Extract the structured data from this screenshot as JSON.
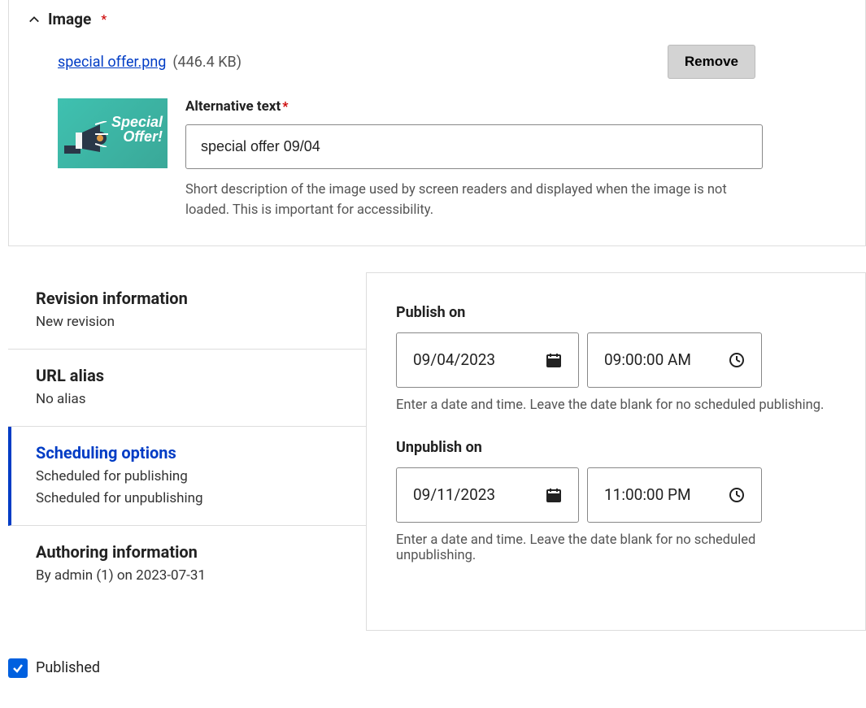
{
  "image_section": {
    "title": "Image",
    "file_name": "special offer.png",
    "file_size": "(446.4 KB)",
    "remove_label": "Remove",
    "thumb_line1": "Special",
    "thumb_line2": "Offer!",
    "alt_label": "Alternative text",
    "alt_value": "special offer 09/04",
    "alt_help": "Short description of the image used by screen readers and displayed when the image is not loaded. This is important for accessibility."
  },
  "tabs": {
    "revision": {
      "title": "Revision information",
      "sub": "New revision"
    },
    "url": {
      "title": "URL alias",
      "sub": "No alias"
    },
    "scheduling": {
      "title": "Scheduling options",
      "sub1": "Scheduled for publishing",
      "sub2": "Scheduled for unpublishing"
    },
    "authoring": {
      "title": "Authoring information",
      "sub": "By admin (1) on 2023-07-31"
    }
  },
  "schedule": {
    "publish_label": "Publish on",
    "publish_date": "09/04/2023",
    "publish_time": "09:00:00 AM",
    "publish_help": "Enter a date and time. Leave the date blank for no scheduled publishing.",
    "unpublish_label": "Unpublish on",
    "unpublish_date": "09/11/2023",
    "unpublish_time": "11:00:00 PM",
    "unpublish_help": "Enter a date and time. Leave the date blank for no scheduled unpublishing."
  },
  "published_label": "Published"
}
